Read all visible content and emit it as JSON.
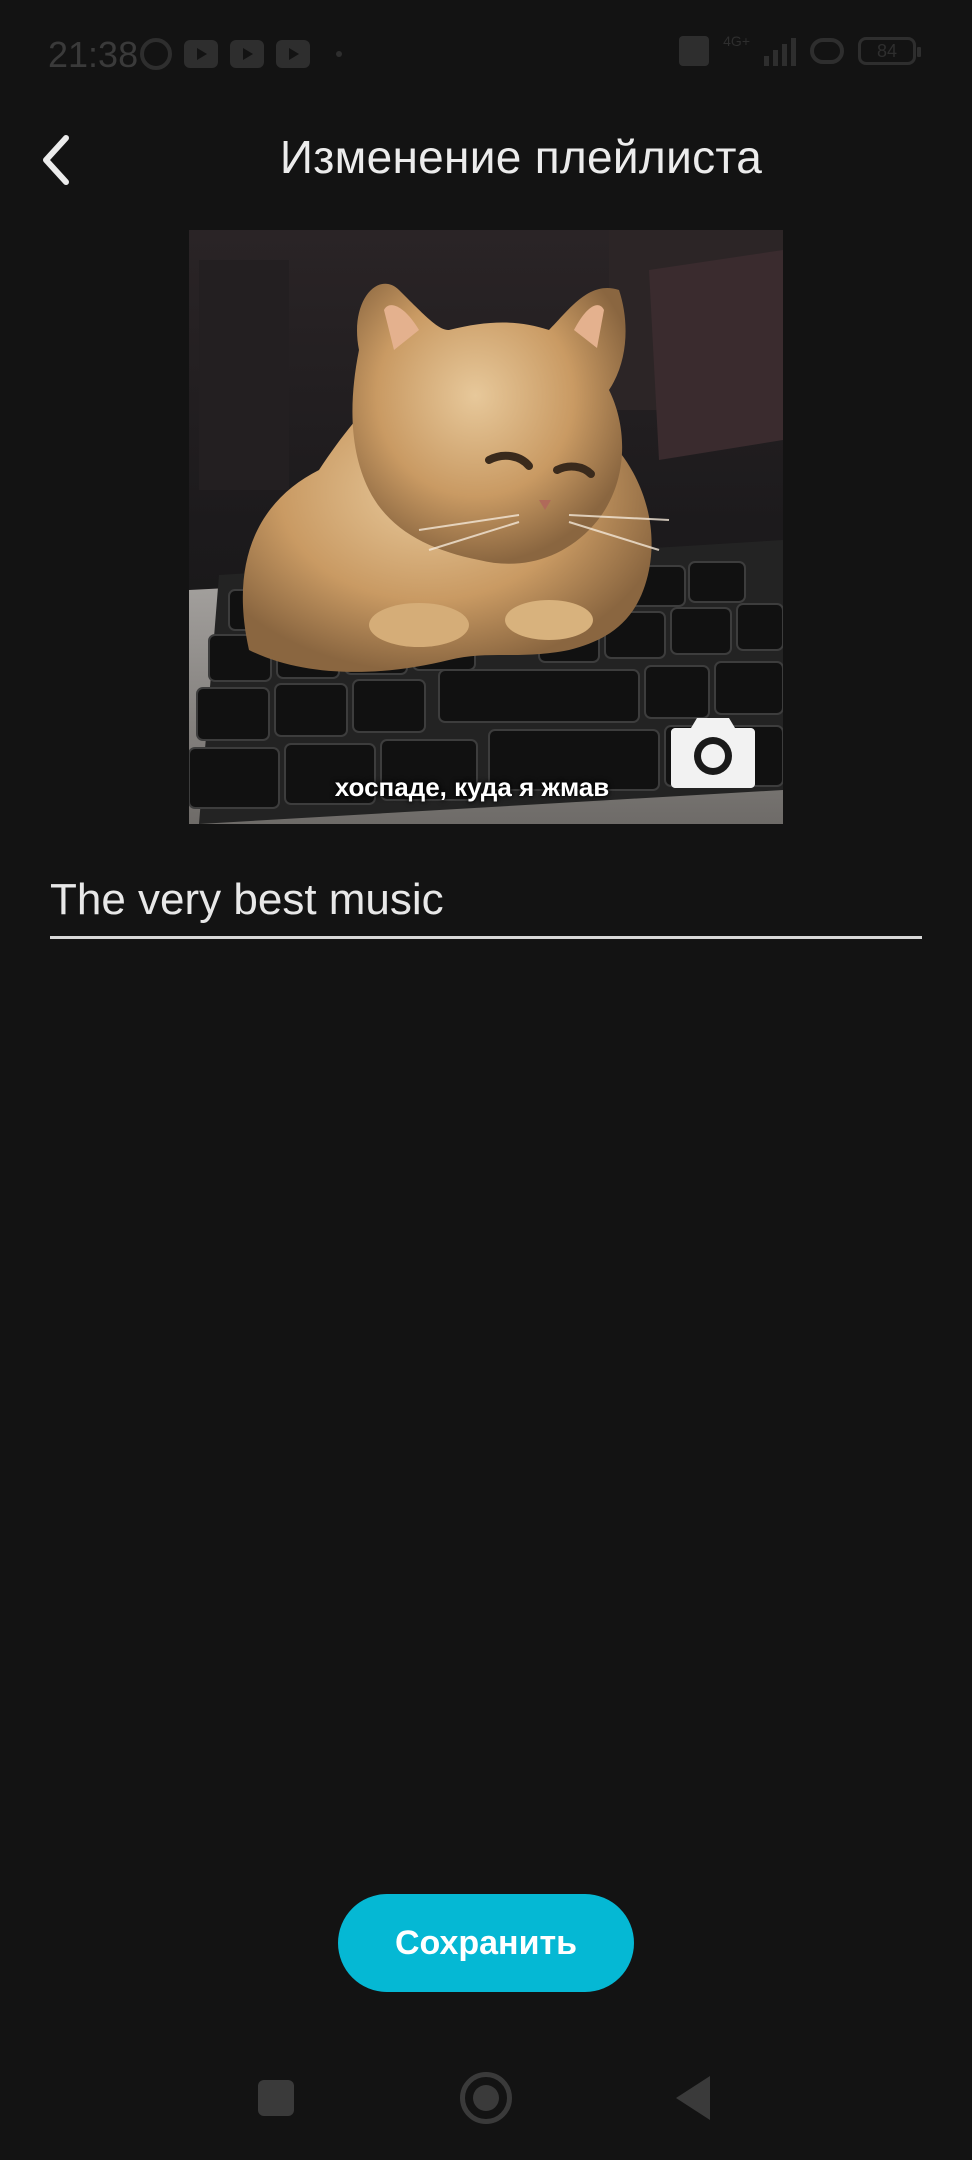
{
  "status_bar": {
    "time": "21:38",
    "network": "4G+",
    "battery": "84"
  },
  "header": {
    "title": "Изменение плейлиста"
  },
  "cover": {
    "caption": "хоспаде, куда я жмав"
  },
  "playlist_name": {
    "value": "The very best music"
  },
  "actions": {
    "save_label": "Сохранить"
  },
  "colors": {
    "background": "#131313",
    "accent": "#05b8d4",
    "text": "#e6e6e6"
  },
  "icons": {
    "back": "chevron-left-icon",
    "camera": "camera-icon",
    "nav_recent": "square-icon",
    "nav_home": "circle-icon",
    "nav_back": "triangle-back-icon"
  }
}
